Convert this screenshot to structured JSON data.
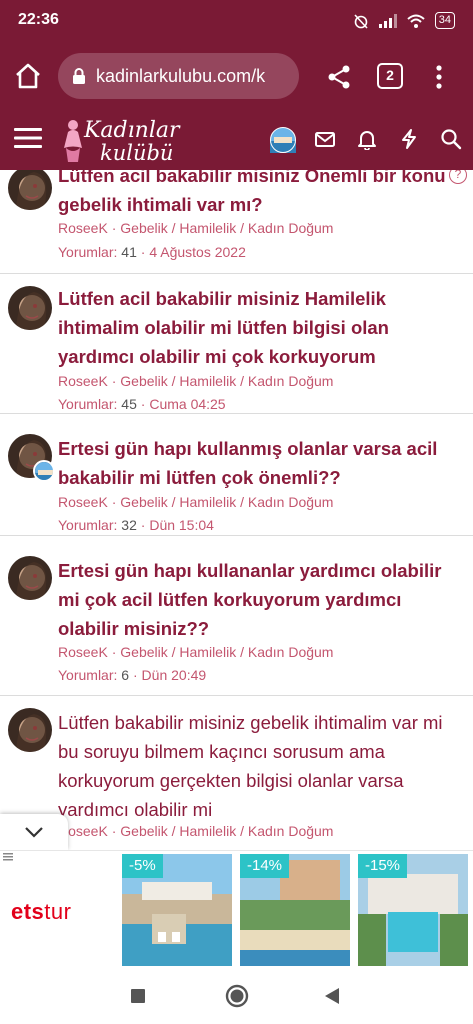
{
  "status_bar": {
    "time": "22:36",
    "battery": "34"
  },
  "browser": {
    "url": "kadinlarkulubu.com/k",
    "tab_count": "2"
  },
  "site": {
    "logo_line1": "Kadınlar",
    "logo_line2": "kulübü"
  },
  "threads": [
    {
      "title": "Lütfen acil bakabilir misiniz Önemli bir konu gebelik ihtimali var mı?",
      "author": "RoseeK",
      "category": "Gebelik / Hamilelik / Kadın Doğum",
      "replies_label": "Yorumlar:",
      "replies": "41",
      "date": "4 Ağustos 2022",
      "unread": true
    },
    {
      "title": "Lütfen acil bakabilir misiniz Hamilelik ihtimalim olabilir mi lütfen bilgisi olan yardımcı olabilir mi çok korkuyorum",
      "author": "RoseeK",
      "category": "Gebelik / Hamilelik / Kadın Doğum",
      "replies_label": "Yorumlar:",
      "replies": "45",
      "date": "Cuma 04:25",
      "unread": true
    },
    {
      "title": "Ertesi gün hapı kullanmış olanlar varsa acil bakabilir mi lütfen çok önemli??",
      "author": "RoseeK",
      "category": "Gebelik / Hamilelik / Kadın Doğum",
      "replies_label": "Yorumlar:",
      "replies": "32",
      "date": "Dün 15:04",
      "unread": true
    },
    {
      "title": "Ertesi gün hapı kullananlar yardımcı olabilir mi çok acil lütfen korkuyorum yardımcı olabilir misiniz??",
      "author": "RoseeK",
      "category": "Gebelik / Hamilelik / Kadın Doğum",
      "replies_label": "Yorumlar:",
      "replies": "6",
      "date": "Dün 20:49",
      "unread": true
    },
    {
      "title": "Lütfen bakabilir misiniz gebelik ihtimalim var mi bu soruyu bilmem kaçıncı sorusum ama korkuyorum gerçekten bilgisi olanlar varsa yardımcı olabilir mi",
      "author": "RoseeK",
      "category": "Gebelik / Hamilelik / Kadın Doğum",
      "unread": false
    }
  ],
  "ad": {
    "brand_ets": "ets",
    "brand_tur": "tur",
    "discounts": [
      "-5%",
      "-14%",
      "-15%"
    ]
  },
  "colors": {
    "brand": "#7a1a35",
    "title": "#8b1c3c",
    "meta": "#c4566f",
    "discount_badge": "#2dc3c7"
  },
  "icons": [
    "home-icon",
    "lock-icon",
    "share-icon",
    "more-vert-icon",
    "hamburger-icon",
    "avatar",
    "mail-icon",
    "bell-icon",
    "bolt-icon",
    "search-icon",
    "help-icon",
    "chevron-down-icon"
  ]
}
